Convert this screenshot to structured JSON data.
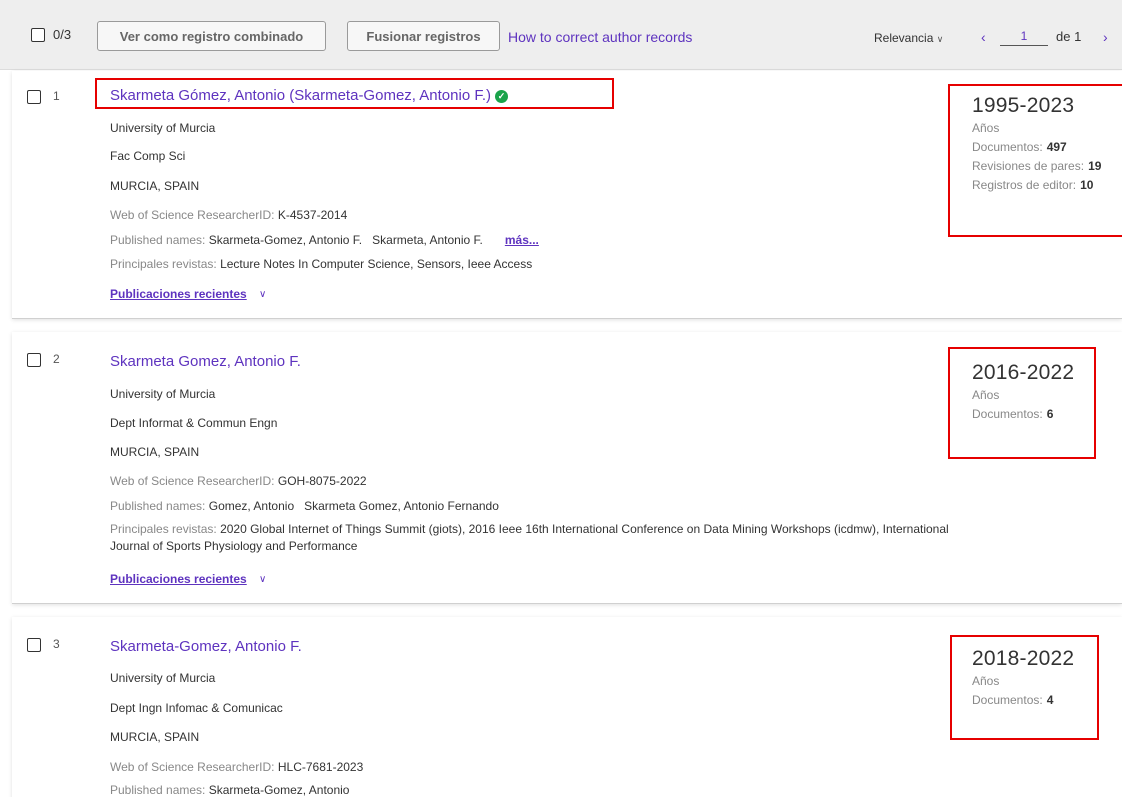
{
  "toolbar": {
    "selected_count": "0/3",
    "combined_view_label": "Ver como registro combinado",
    "merge_label": "Fusionar registros",
    "help_link": "How to correct author records",
    "sort_label": "Relevancia",
    "page_current": "1",
    "page_of": "de 1"
  },
  "results": [
    {
      "index": "1",
      "name": "Skarmeta Gómez, Antonio (Skarmeta-Gomez, Antonio F.)",
      "verified": true,
      "org": "University of Murcia",
      "dept": "Fac Comp Sci",
      "location": "MURCIA, SPAIN",
      "researcher_id_label": "Web of Science ResearcherID:",
      "researcher_id": "K-4537-2014",
      "published_names_label": "Published names:",
      "published_names": "Skarmeta-Gomez, Antonio F.   Skarmeta, Antonio F.",
      "more_label": "más...",
      "journals_label": "Principales revistas:",
      "journals": "Lecture Notes In Computer Science, Sensors, Ieee Access",
      "recent_label": "Publicaciones recientes",
      "years": "1995-2023",
      "years_label": "Años",
      "documents_label": "Documentos:",
      "documents": "497",
      "peer_reviews_label": "Revisiones de pares:",
      "peer_reviews": "19",
      "editor_records_label": "Registros de editor:",
      "editor_records": "10"
    },
    {
      "index": "2",
      "name": "Skarmeta Gomez, Antonio F.",
      "org": "University of Murcia",
      "dept": "Dept Informat & Commun Engn",
      "location": "MURCIA, SPAIN",
      "researcher_id_label": "Web of Science ResearcherID:",
      "researcher_id": "GOH-8075-2022",
      "published_names_label": "Published names:",
      "published_names": "Gomez, Antonio   Skarmeta Gomez, Antonio Fernando",
      "journals_label": "Principales revistas:",
      "journals": "2020 Global Internet of Things Summit (giots), 2016 Ieee 16th International Conference on Data Mining Workshops (icdmw), International Journal of Sports Physiology and Performance",
      "recent_label": "Publicaciones recientes",
      "years": "2016-2022",
      "years_label": "Años",
      "documents_label": "Documentos:",
      "documents": "6"
    },
    {
      "index": "3",
      "name": "Skarmeta-Gomez, Antonio F.",
      "org": "University of Murcia",
      "dept": "Dept Ingn Infomac & Comunicac",
      "location": "MURCIA, SPAIN",
      "researcher_id_label": "Web of Science ResearcherID:",
      "researcher_id": "HLC-7681-2023",
      "published_names_label": "Published names:",
      "published_names": "Skarmeta-Gomez, Antonio",
      "years": "2018-2022",
      "years_label": "Años",
      "documents_label": "Documentos:",
      "documents": "4"
    }
  ],
  "colors": {
    "link": "#5e33bf",
    "highlight": "#e60000",
    "verified": "#1aa34a"
  },
  "icons": [
    "checkbox-icon",
    "chevron-down-icon",
    "chevron-left-icon",
    "chevron-right-icon",
    "verified-check-icon"
  ]
}
